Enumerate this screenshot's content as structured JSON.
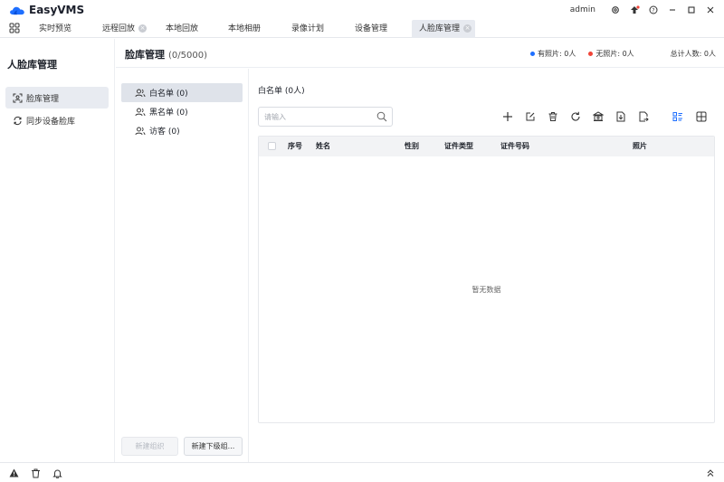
{
  "app": {
    "name": "EasyVMS",
    "user": "admin",
    "icons": [
      "settings-icon",
      "upgrade-icon",
      "help-icon",
      "minimize-icon",
      "maximize-icon",
      "close-icon"
    ]
  },
  "tabs": [
    {
      "label": "实时预览"
    },
    {
      "label": "远程回放",
      "closable": true
    },
    {
      "label": "本地回放"
    },
    {
      "label": "本地相册"
    },
    {
      "label": "录像计划"
    },
    {
      "label": "设备管理"
    },
    {
      "label": "人脸库管理",
      "closable": true,
      "active": true
    }
  ],
  "sidebar": {
    "title": "人脸库管理",
    "items": [
      {
        "label": "脸库管理",
        "icon": "face-scan-icon",
        "active": true
      },
      {
        "label": "同步设备脸库",
        "icon": "sync-icon"
      }
    ]
  },
  "header": {
    "title": "脸库管理",
    "count": "(0/5000)",
    "stats": [
      {
        "label": "有照片: 0人",
        "color": "#1e6fff"
      },
      {
        "label": "无照片: 0人",
        "color": "#f04438"
      },
      {
        "label": "总计人数: 0人"
      }
    ]
  },
  "groups": {
    "items": [
      {
        "label": "白名单 (0)",
        "active": true
      },
      {
        "label": "黑名单 (0)"
      },
      {
        "label": "访客 (0)"
      }
    ],
    "new_group_button": "新建组织",
    "new_subgroup_button": "新建下级组..."
  },
  "main": {
    "title": "白名单 (0人)",
    "search_placeholder": "请输入",
    "toolbar_icons": [
      "add-icon",
      "edit-icon",
      "delete-icon",
      "refresh-icon",
      "bank-import-icon",
      "import-icon",
      "export-icon",
      "list-view-icon",
      "grid-view-icon"
    ],
    "columns": [
      "序号",
      "姓名",
      "性别",
      "证件类型",
      "证件号码",
      "照片"
    ],
    "empty_text": "暂无数据"
  },
  "bottombar": {
    "icons": [
      "warning-icon",
      "trash-icon",
      "bell-icon",
      "expand-up-icon"
    ]
  },
  "colors": {
    "accent": "#1e6fff",
    "danger": "#f04438",
    "active_bg": "#e8ebf1"
  }
}
